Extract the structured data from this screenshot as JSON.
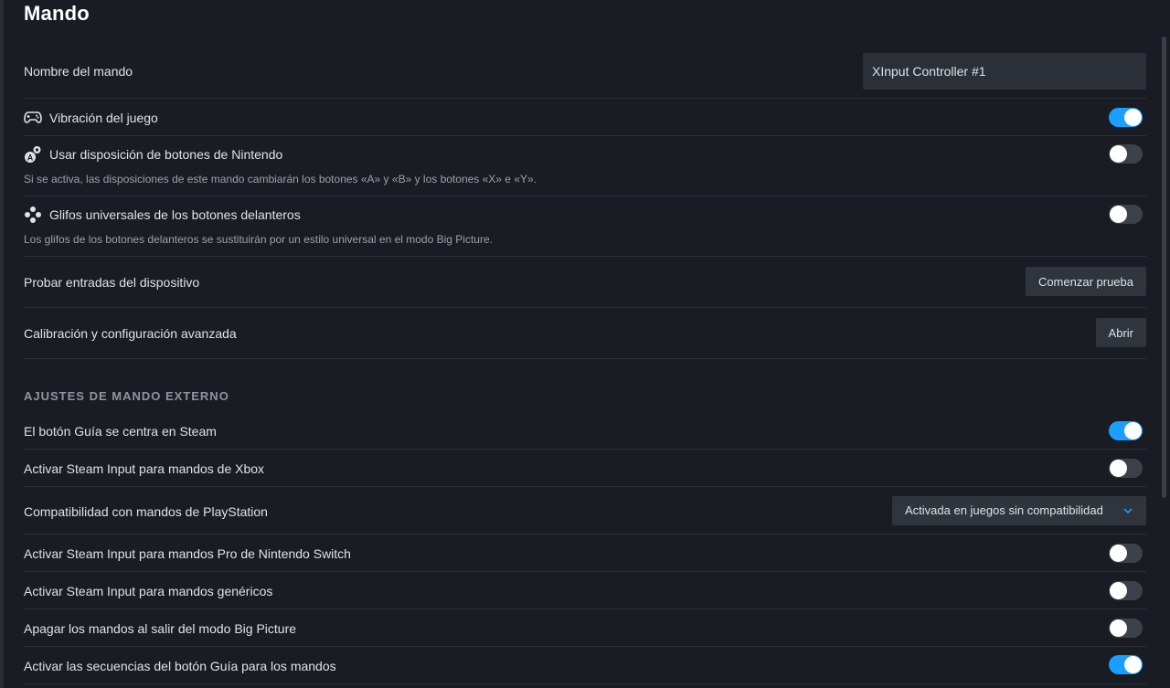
{
  "page": {
    "title": "Mando"
  },
  "controller_name": {
    "label": "Nombre del mando",
    "value": "XInput Controller #1"
  },
  "settings": [
    {
      "label": "Vibración del juego",
      "icon": "gamepad-icon",
      "enabled": true
    },
    {
      "label": "Usar disposición de botones de Nintendo",
      "icon": "button-layout-icon",
      "enabled": false,
      "description": "Si se activa, las disposiciones de este mando cambiarán los botones «A» y «B» y los botones «X» e «Y»."
    },
    {
      "label": "Glifos universales de los botones delanteros",
      "icon": "face-buttons-icon",
      "enabled": false,
      "description": "Los glifos de los botones delanteros se sustituirán por un estilo universal en el modo Big Picture."
    }
  ],
  "test_inputs": {
    "label": "Probar entradas del dispositivo",
    "button": "Comenzar prueba"
  },
  "calibration": {
    "label": "Calibración y configuración avanzada",
    "button": "Abrir"
  },
  "external_section": {
    "header": "AJUSTES DE MANDO EXTERNO",
    "guide_focus": {
      "label": "El botón Guía se centra en Steam",
      "enabled": true
    },
    "xbox_input": {
      "label": "Activar Steam Input para mandos de Xbox",
      "enabled": false
    },
    "playstation": {
      "label": "Compatibilidad con mandos de PlayStation",
      "selected": "Activada en juegos sin compatibilidad"
    },
    "switch_pro": {
      "label": "Activar Steam Input para mandos Pro de Nintendo Switch",
      "enabled": false
    },
    "generic": {
      "label": "Activar Steam Input para mandos genéricos",
      "enabled": false
    },
    "turn_off": {
      "label": "Apagar los mandos al salir del modo Big Picture",
      "enabled": false
    },
    "guide_chords": {
      "label": "Activar las secuencias del botón Guía para los mandos",
      "enabled": true
    }
  },
  "colors": {
    "background": "#191c23",
    "accent": "#1a9fff",
    "toggle_off": "#3c414b"
  }
}
